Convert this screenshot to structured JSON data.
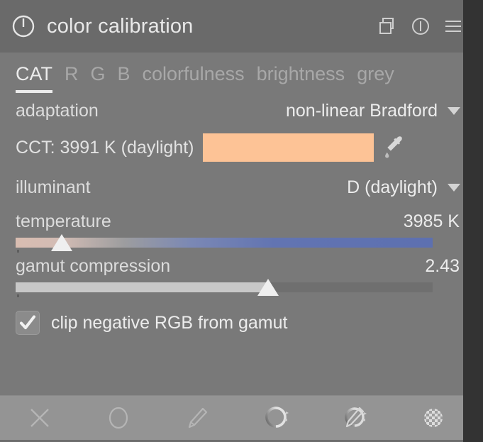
{
  "module": {
    "title": "color calibration",
    "power_icon": "power-icon",
    "header_icons": [
      {
        "name": "multi-instance-icon"
      },
      {
        "name": "reset-icon"
      },
      {
        "name": "presets-menu-icon"
      }
    ]
  },
  "tabs": [
    {
      "label": "CAT",
      "active": true
    },
    {
      "label": "R",
      "active": false
    },
    {
      "label": "G",
      "active": false
    },
    {
      "label": "B",
      "active": false
    },
    {
      "label": "colorfulness",
      "active": false
    },
    {
      "label": "brightness",
      "active": false
    },
    {
      "label": "grey",
      "active": false
    }
  ],
  "adaptation": {
    "label": "adaptation",
    "value": "non-linear Bradford",
    "arrow": "chevron-down-icon"
  },
  "cct": {
    "label": "CCT: 3991 K (daylight)",
    "swatch_color": "#fdc396",
    "picker_icon": "eyedropper-icon"
  },
  "illuminant": {
    "label": "illuminant",
    "value": "D (daylight)",
    "arrow": "chevron-down-icon"
  },
  "temperature": {
    "label": "temperature",
    "value": "3985 K",
    "handle_percent": 11,
    "gradient_from": "#d9bdb1",
    "gradient_to": "#5d70b0"
  },
  "gamut": {
    "label": "gamut compression",
    "value": "2.43",
    "handle_percent": 60.5,
    "fill_color": "#c8c8c8",
    "track_color": "#6f6f6f"
  },
  "clip_negative": {
    "label": "clip negative RGB from gamut",
    "checked": true
  },
  "mask_toolbar": [
    {
      "name": "mask-off-icon"
    },
    {
      "name": "uniform-mask-icon"
    },
    {
      "name": "drawn-mask-icon"
    },
    {
      "name": "parametric-mask-icon"
    },
    {
      "name": "drawn-and-parametric-mask-icon"
    },
    {
      "name": "raster-mask-icon"
    }
  ],
  "colors": {
    "panel_bg": "#797979",
    "header_bg": "#6a6a6a",
    "maskbar_bg": "#949494",
    "text": "#ececec",
    "muted_text": "#a8a8a8"
  }
}
